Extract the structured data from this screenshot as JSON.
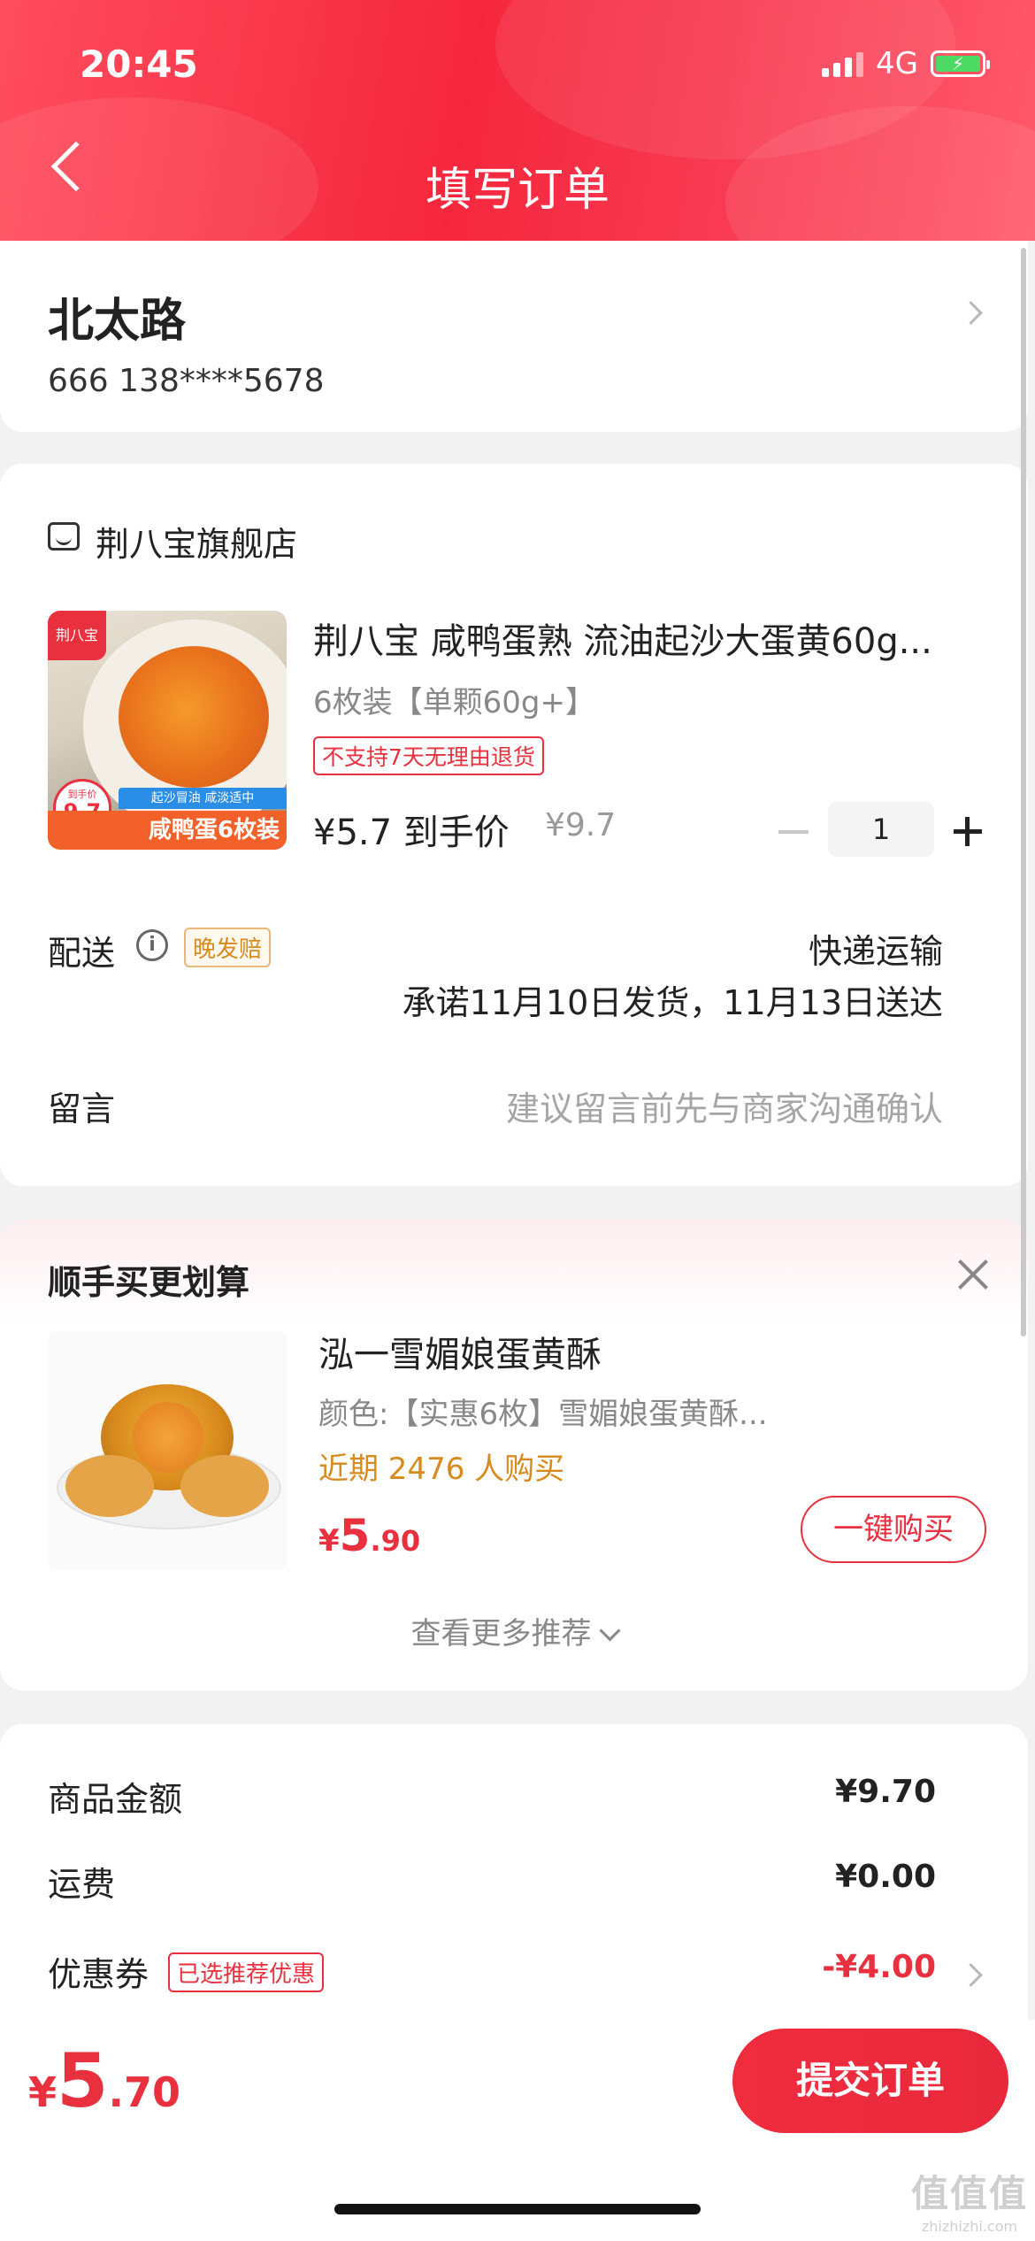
{
  "status_bar": {
    "time": "20:45",
    "network": "4G"
  },
  "header": {
    "title": "填写订单"
  },
  "address": {
    "name": "北太路",
    "contact": "666  138****5678"
  },
  "store": {
    "name": "荆八宝旗舰店"
  },
  "product": {
    "title": "荆八宝 咸鸭蛋熟 流油起沙大蛋黄60g...",
    "spec": "6枚装【单颗60g+】",
    "tag": "不支持7天无理由退货",
    "price_label": "¥5.7 到手价",
    "original_price": "¥9.7",
    "quantity": "1",
    "image_texts": {
      "brand": "荆八宝",
      "badge_top": "到手价",
      "badge_value": "9.7",
      "slogan": "起沙冒油 咸淡适中",
      "banner": "咸鸭蛋6枚装"
    }
  },
  "delivery": {
    "label": "配送",
    "tag": "晚发赔",
    "method": "快递运输",
    "promise": "承诺11月10日发货，11月13日送达"
  },
  "message": {
    "label": "留言",
    "placeholder": "建议留言前先与商家沟通确认"
  },
  "suggestion": {
    "section_title": "顺手买更划算",
    "item_title": "泓一雪媚娘蛋黄酥",
    "item_spec": "颜色:【实惠6枚】雪媚娘蛋黄酥...",
    "item_sales": "近期 2476 人购买",
    "price_symbol": "¥",
    "price_int": "5",
    "price_dec": ".90",
    "buy_label": "一键购买",
    "more_label": "查看更多推荐"
  },
  "summary": {
    "goods_label": "商品金额",
    "goods_value": "¥9.70",
    "shipping_label": "运费",
    "shipping_value": "¥0.00",
    "coupon_label": "优惠券",
    "coupon_tag": "已选推荐优惠",
    "coupon_value": "-¥4.00"
  },
  "footer": {
    "total_symbol": "¥",
    "total_int": "5",
    "total_dec": ".70",
    "submit_label": "提交订单"
  },
  "watermark": {
    "line1": "值值值",
    "line2": "zhizhizhi.com"
  },
  "colors": {
    "accent": "#e8303f",
    "orange": "#d98a1d"
  }
}
